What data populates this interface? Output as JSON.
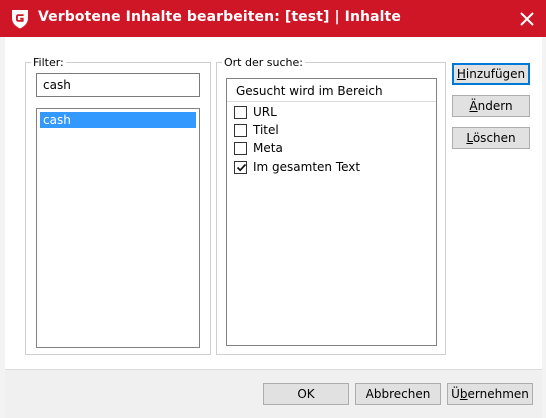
{
  "window": {
    "title": "Verbotene Inhalte bearbeiten: [test] | Inhalte",
    "brand_color": "#cf1626"
  },
  "filter": {
    "group_label": "Filter:",
    "input_value": "cash",
    "list_items": [
      "cash"
    ],
    "selected_index": 0
  },
  "search_location": {
    "group_label": "Ort der suche:",
    "header": "Gesucht wird im Bereich",
    "options": [
      {
        "label": "URL",
        "checked": false
      },
      {
        "label": "Titel",
        "checked": false
      },
      {
        "label": "Meta",
        "checked": false
      },
      {
        "label": "Im gesamten Text",
        "checked": true
      }
    ]
  },
  "side_buttons": {
    "add": {
      "accel": "H",
      "rest": "inzufügen"
    },
    "change": {
      "accel": "Ä",
      "rest": "ndern"
    },
    "delete": {
      "accel": "L",
      "rest": "öschen"
    }
  },
  "footer_buttons": {
    "ok": "OK",
    "cancel": "Abbrechen",
    "apply": {
      "prefix": "Ü",
      "accel": "b",
      "rest": "ernehmen"
    }
  }
}
